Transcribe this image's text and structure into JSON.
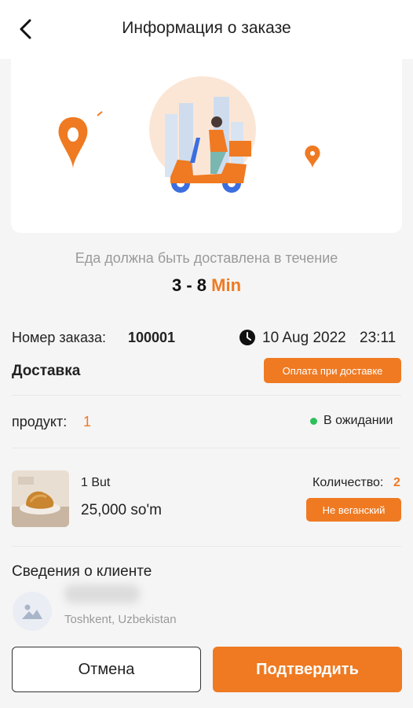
{
  "header": {
    "title": "Информация о заказе",
    "back_icon": "chevron-left-icon"
  },
  "hero": {
    "illustration": "scooter-delivery-illustration",
    "left_icon": "map-pin-icon",
    "right_icon": "map-pin-icon"
  },
  "eta": {
    "text": "Еда должна быть доставлена в течение",
    "range": "3 - 8",
    "unit": "Min"
  },
  "order": {
    "number_label": "Номер заказа:",
    "number": "100001",
    "date": "10 Aug 2022",
    "time": "23:11",
    "delivery_label": "Доставка",
    "payment_badge": "Оплата при доставке"
  },
  "products": {
    "label": "продукт:",
    "count": "1",
    "status": "В ожидании",
    "status_color": "#2cc05a"
  },
  "item": {
    "name": "1 But",
    "price": "25,000 so'm",
    "quantity_label": "Количество:",
    "quantity": "2",
    "badge": "Не веганский"
  },
  "client": {
    "title": "Сведения о клиенте",
    "address": "Toshkent, Uzbekistan",
    "avatar_icon": "image-placeholder-icon"
  },
  "actions": {
    "cancel": "Отмена",
    "confirm": "Подтвердить"
  },
  "colors": {
    "accent": "#ef7a22",
    "background": "#f5f5f5"
  }
}
